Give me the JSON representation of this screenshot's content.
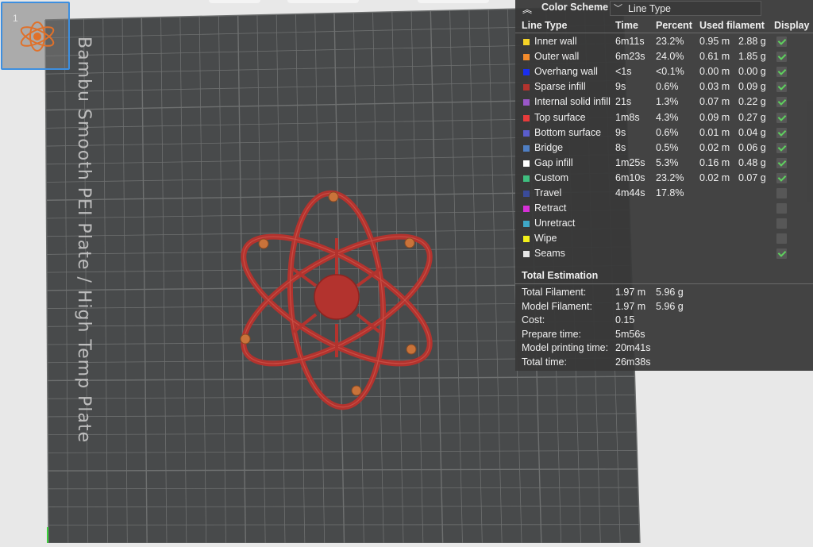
{
  "plate": {
    "label": "Bambu Smooth PEI Plate / High Temp Plate",
    "thumbnail_number": "1"
  },
  "color_scheme": {
    "title": "Color Scheme",
    "selected": "Line Type"
  },
  "table": {
    "headers": {
      "line_type": "Line Type",
      "time": "Time",
      "percent": "Percent",
      "used_filament": "Used filament",
      "display": "Display"
    },
    "rows": [
      {
        "name": "Inner wall",
        "color": "#f5d327",
        "time": "6m11s",
        "percent": "23.2%",
        "meters": "0.95 m",
        "grams": "2.88 g",
        "display": true
      },
      {
        "name": "Outer wall",
        "color": "#f38b2c",
        "time": "6m23s",
        "percent": "24.0%",
        "meters": "0.61 m",
        "grams": "1.85 g",
        "display": true
      },
      {
        "name": "Overhang wall",
        "color": "#1a2ef0",
        "time": "<1s",
        "percent": "<0.1%",
        "meters": "0.00 m",
        "grams": "0.00 g",
        "display": true
      },
      {
        "name": "Sparse infill",
        "color": "#b3332e",
        "time": "9s",
        "percent": "0.6%",
        "meters": "0.03 m",
        "grams": "0.09 g",
        "display": true
      },
      {
        "name": "Internal solid infill",
        "color": "#9a57c9",
        "time": "21s",
        "percent": "1.3%",
        "meters": "0.07 m",
        "grams": "0.22 g",
        "display": true
      },
      {
        "name": "Top surface",
        "color": "#e83b3b",
        "time": "1m8s",
        "percent": "4.3%",
        "meters": "0.09 m",
        "grams": "0.27 g",
        "display": true
      },
      {
        "name": "Bottom surface",
        "color": "#5a5dcc",
        "time": "9s",
        "percent": "0.6%",
        "meters": "0.01 m",
        "grams": "0.04 g",
        "display": true
      },
      {
        "name": "Bridge",
        "color": "#4f7fc4",
        "time": "8s",
        "percent": "0.5%",
        "meters": "0.02 m",
        "grams": "0.06 g",
        "display": true
      },
      {
        "name": "Gap infill",
        "color": "#ffffff",
        "time": "1m25s",
        "percent": "5.3%",
        "meters": "0.16 m",
        "grams": "0.48 g",
        "display": true
      },
      {
        "name": "Custom",
        "color": "#3fbf7f",
        "time": "6m10s",
        "percent": "23.2%",
        "meters": "0.02 m",
        "grams": "0.07 g",
        "display": true
      },
      {
        "name": "Travel",
        "color": "#3a4b9a",
        "time": "4m44s",
        "percent": "17.8%",
        "meters": "",
        "grams": "",
        "display": false
      },
      {
        "name": "Retract",
        "color": "#d630d6",
        "time": "",
        "percent": "",
        "meters": "",
        "grams": "",
        "display": false
      },
      {
        "name": "Unretract",
        "color": "#3fa8c8",
        "time": "",
        "percent": "",
        "meters": "",
        "grams": "",
        "display": false
      },
      {
        "name": "Wipe",
        "color": "#f2f01a",
        "time": "",
        "percent": "",
        "meters": "",
        "grams": "",
        "display": false
      },
      {
        "name": "Seams",
        "color": "#e6e6e6",
        "time": "",
        "percent": "",
        "meters": "",
        "grams": "",
        "display": true
      }
    ]
  },
  "total_estimation": {
    "title": "Total Estimation",
    "rows": [
      {
        "label": "Total Filament:",
        "v1": "1.97 m",
        "v2": "5.96 g"
      },
      {
        "label": "Model Filament:",
        "v1": "1.97 m",
        "v2": "5.96 g"
      },
      {
        "label": "Cost:",
        "v1": "0.15",
        "v2": ""
      },
      {
        "label": "Prepare time:",
        "v1": "5m56s",
        "v2": ""
      },
      {
        "label": "Model printing time:",
        "v1": "20m41s",
        "v2": ""
      },
      {
        "label": "Total time:",
        "v1": "26m38s",
        "v2": ""
      }
    ]
  },
  "colors": {
    "plate": "#484a4b",
    "grid": "#6e7070",
    "model": "#b3332e",
    "nodes": "#c9733a",
    "check": "#5fd15f"
  }
}
